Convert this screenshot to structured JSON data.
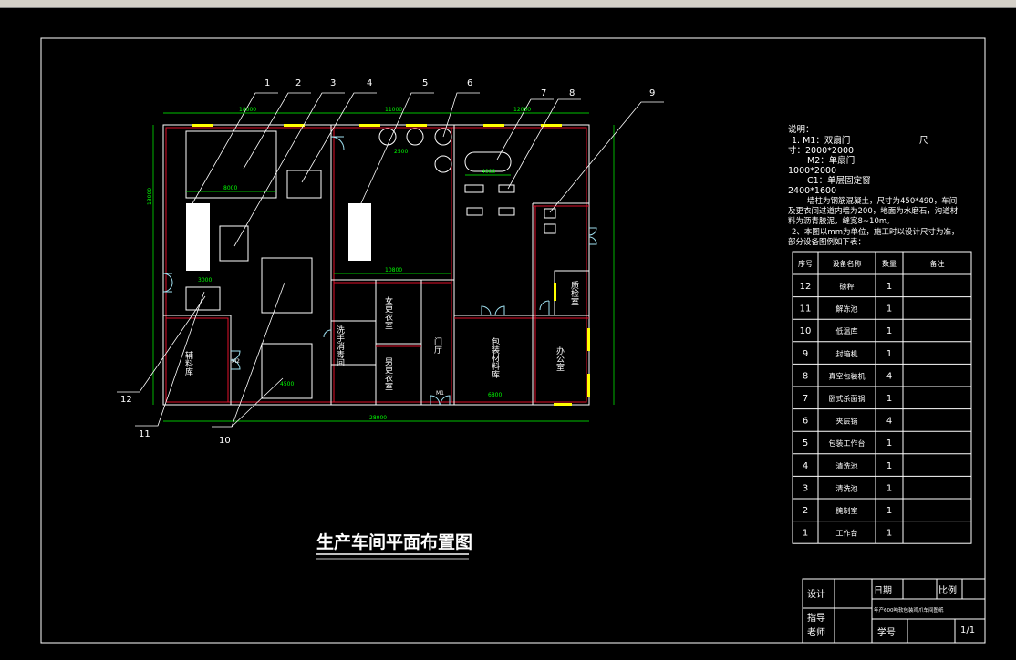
{
  "drawing_title": "生产车间平面布置图",
  "notes": [
    "说明：",
    "1. M1：双扇门",
    "尺",
    "寸：2000*2000",
    "M2：单扇门",
    "1000*2000",
    "C1：单层固定窗",
    "2400*1600",
    "墙柱为钢筋混凝土，尺寸为450*490，车间",
    "及更衣间过道内墙为200，地面为水磨石，沟道材",
    "料为沥青胶泥，缝宽8~10m。",
    "2、本图以mm为单位，施工时以设计尺寸为准，",
    "部分设备图例如下表："
  ],
  "equipment_table": {
    "headers": [
      "序号",
      "设备名称",
      "数量",
      "备注"
    ],
    "rows": [
      {
        "no": "12",
        "name": "磅秤",
        "qty": "1",
        "remark": ""
      },
      {
        "no": "11",
        "name": "解冻池",
        "qty": "1",
        "remark": ""
      },
      {
        "no": "10",
        "name": "低温库",
        "qty": "1",
        "remark": ""
      },
      {
        "no": "9",
        "name": "封箱机",
        "qty": "1",
        "remark": ""
      },
      {
        "no": "8",
        "name": "真空包装机",
        "qty": "4",
        "remark": ""
      },
      {
        "no": "7",
        "name": "卧式杀菌锅",
        "qty": "1",
        "remark": ""
      },
      {
        "no": "6",
        "name": "夹层锅",
        "qty": "4",
        "remark": ""
      },
      {
        "no": "5",
        "name": "包装工作台",
        "qty": "1",
        "remark": ""
      },
      {
        "no": "4",
        "name": "清洗池",
        "qty": "1",
        "remark": ""
      },
      {
        "no": "3",
        "name": "清洗池",
        "qty": "1",
        "remark": ""
      },
      {
        "no": "2",
        "name": "腌制室",
        "qty": "1",
        "remark": ""
      },
      {
        "no": "1",
        "name": "工作台",
        "qty": "1",
        "remark": ""
      }
    ]
  },
  "title_block": {
    "design": "设计",
    "advisor_1": "指导",
    "advisor_2": "老师",
    "date": "日期",
    "scale": "比例",
    "drawing_name": "年产600吨软包装鸡爪车间图纸",
    "student_no": "学号",
    "sheet": "1/1"
  },
  "rooms": {
    "aux_storage": "辅料库",
    "wash_disinfect": "洗手消毒间",
    "female_locker": "女更衣室",
    "male_locker": "男更衣室",
    "lobby": "门厅",
    "packaging_storage": "包装材料库",
    "office": "办公室",
    "qc_room": "质检室"
  },
  "callouts": [
    "1",
    "2",
    "3",
    "4",
    "5",
    "6",
    "7",
    "8",
    "9",
    "10",
    "11",
    "12"
  ],
  "dimensions": {
    "top_left": "18000",
    "top_mid": "11000",
    "top_right": "12000",
    "bottom_total": "28000",
    "left_total": "13000",
    "mid_span": "10800",
    "d2500": "2500",
    "d4000": "4000",
    "d8000": "8000",
    "d3000": "3000",
    "d4500": "4500",
    "d6800": "6800"
  },
  "door_labels": {
    "m1": "M1",
    "m2": "M2"
  },
  "colors": {
    "background": "#000000",
    "wall": "#ffffff",
    "wall_inner": "#e0102a",
    "dimension": "#00ff00",
    "window": "#ffff00",
    "door": "#9fe0f0"
  }
}
